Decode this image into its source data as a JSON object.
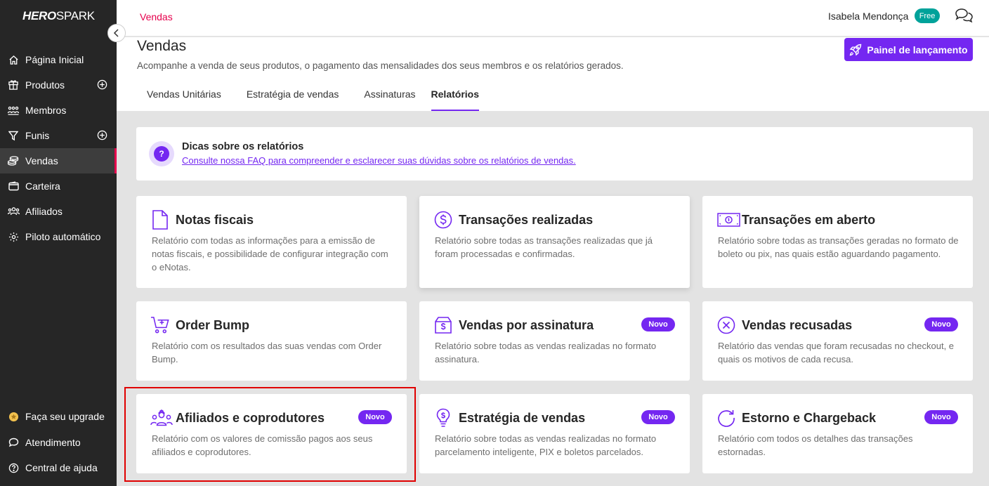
{
  "brand": {
    "logo_bold": "HERO",
    "logo_light": "SPARK"
  },
  "sidebar": {
    "items": [
      {
        "label": "Página Inicial",
        "icon": "home-icon",
        "plus": false,
        "active": false
      },
      {
        "label": "Produtos",
        "icon": "box-icon",
        "plus": true,
        "active": false
      },
      {
        "label": "Membros",
        "icon": "members-icon",
        "plus": false,
        "active": false
      },
      {
        "label": "Funis",
        "icon": "funnel-icon",
        "plus": true,
        "active": false
      },
      {
        "label": "Vendas",
        "icon": "coins-icon",
        "plus": false,
        "active": true
      },
      {
        "label": "Carteira",
        "icon": "wallet-icon",
        "plus": false,
        "active": false
      },
      {
        "label": "Afiliados",
        "icon": "affiliates-icon",
        "plus": false,
        "active": false
      },
      {
        "label": "Piloto automático",
        "icon": "gear-icon",
        "plus": false,
        "active": false
      }
    ],
    "bottom": [
      {
        "label": "Faça seu upgrade",
        "icon": "star-icon"
      },
      {
        "label": "Atendimento",
        "icon": "chat-icon"
      },
      {
        "label": "Central de ajuda",
        "icon": "help-icon"
      }
    ]
  },
  "header": {
    "breadcrumb": "Vendas",
    "user_name": "Isabela Mendonça",
    "plan_badge": "Free"
  },
  "page": {
    "title": "Vendas",
    "subtitle": "Acompanhe a venda de seus produtos, o pagamento das mensalidades dos seus membros e os relatórios gerados.",
    "launch_button": "Painel de lançamento",
    "tabs": [
      "Vendas Unitárias",
      "Estratégia de vendas",
      "Assinaturas",
      "Relatórios"
    ],
    "active_tab": "Relatórios"
  },
  "tips": {
    "title": "Dicas sobre os relatórios",
    "link": "Consulte nossa FAQ para compreender e esclarecer suas dúvidas sobre os relatórios de vendas."
  },
  "badge_label": "Novo",
  "cards": [
    {
      "title": "Notas fiscais",
      "desc": "Relatório com todas as informações para a emissão de notas fiscais, e possibilidade de configurar integração com o eNotas.",
      "icon": "document-icon",
      "new": false
    },
    {
      "title": "Transações realizadas",
      "desc": "Relatório sobre todas as transações realizadas que já foram processadas e confirmadas.",
      "icon": "dollar-circle-icon",
      "new": false
    },
    {
      "title": "Transações em aberto",
      "desc": "Relatório sobre todas as transações geradas no formato de boleto ou pix, nas quais estão aguardando pagamento.",
      "icon": "banknote-icon",
      "new": false
    },
    {
      "title": "Order Bump",
      "desc": "Relatório com os resultados das suas vendas com Order Bump.",
      "icon": "cart-plus-icon",
      "new": false
    },
    {
      "title": "Vendas por assinatura",
      "desc": "Relatório sobre todas as vendas realizadas no formato assinatura.",
      "icon": "subscription-box-icon",
      "new": true
    },
    {
      "title": "Vendas recusadas",
      "desc": "Relatório das vendas que foram recusadas no checkout, e quais os motivos de cada recusa.",
      "icon": "x-circle-icon",
      "new": true
    },
    {
      "title": "Afiliados e coprodutores",
      "desc": "Relatório com os valores de comissão pagos aos seus afiliados e coprodutores.",
      "icon": "people-group-icon",
      "new": true
    },
    {
      "title": "Estratégia de vendas",
      "desc": "Relatório sobre todas as vendas realizadas no formato parcelamento inteligente, PIX e boletos parcelados.",
      "icon": "lightbulb-icon",
      "new": true
    },
    {
      "title": "Estorno e Chargeback",
      "desc": "Relatório com todos os detalhes das transações estornadas.",
      "icon": "refresh-icon",
      "new": true
    }
  ],
  "colors": {
    "accent": "#7427f1",
    "brand_red": "#e6004c",
    "free_badge": "#00a29a",
    "sidebar_bg": "#262626"
  }
}
